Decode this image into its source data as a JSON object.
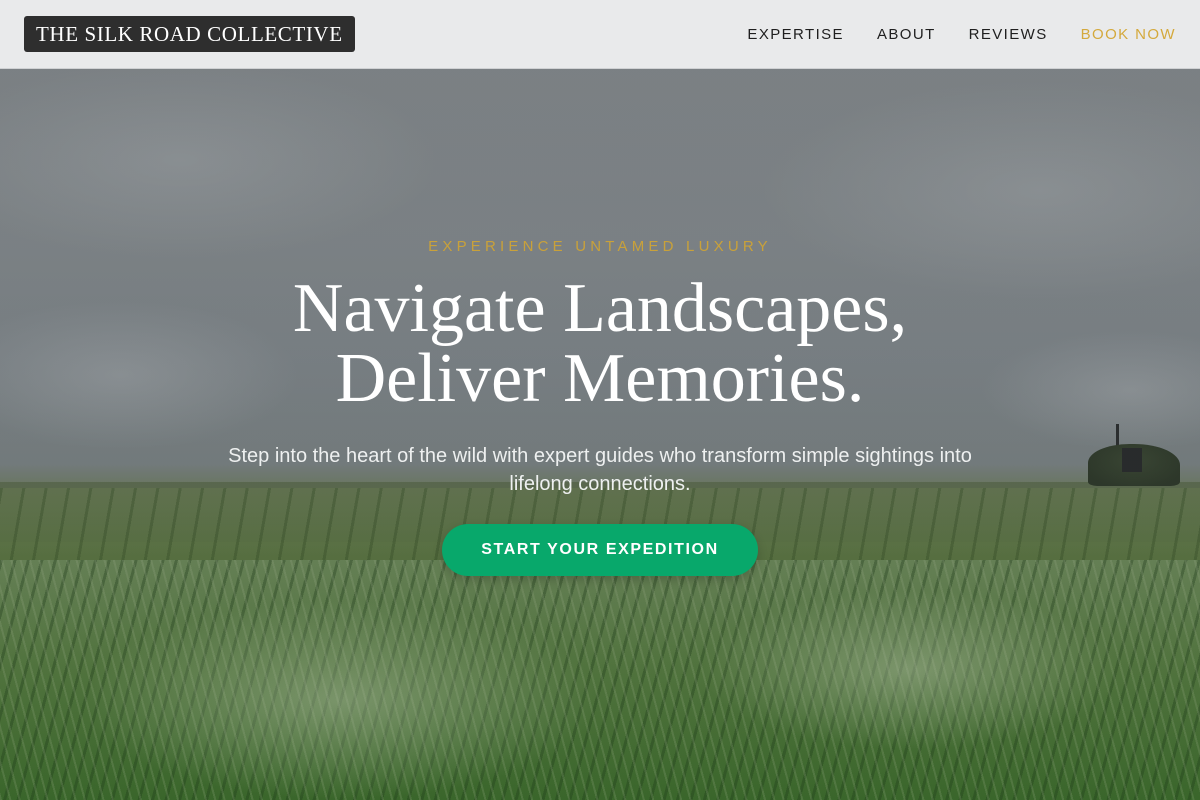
{
  "header": {
    "logo_text": "THE SILK ROAD COLLECTIVE",
    "nav": [
      {
        "label": "EXPERTISE"
      },
      {
        "label": "ABOUT"
      },
      {
        "label": "REVIEWS"
      },
      {
        "label": "BOOK NOW"
      }
    ]
  },
  "hero": {
    "eyebrow": "EXPERIENCE UNTAMED LUXURY",
    "headline_line1": "Navigate Landscapes,",
    "headline_line2": "Deliver Memories.",
    "subtext": "Step into the heart of the wild with expert guides who transform simple sightings into lifelong connections.",
    "cta_label": "START YOUR EXPEDITION",
    "background_image": "wheat-field-landscape"
  },
  "colors": {
    "accent_gold": "#d4a93c",
    "cta_green": "#08a86b",
    "header_bg": "#e9eaeb",
    "logo_bg": "#2e2e2e"
  }
}
